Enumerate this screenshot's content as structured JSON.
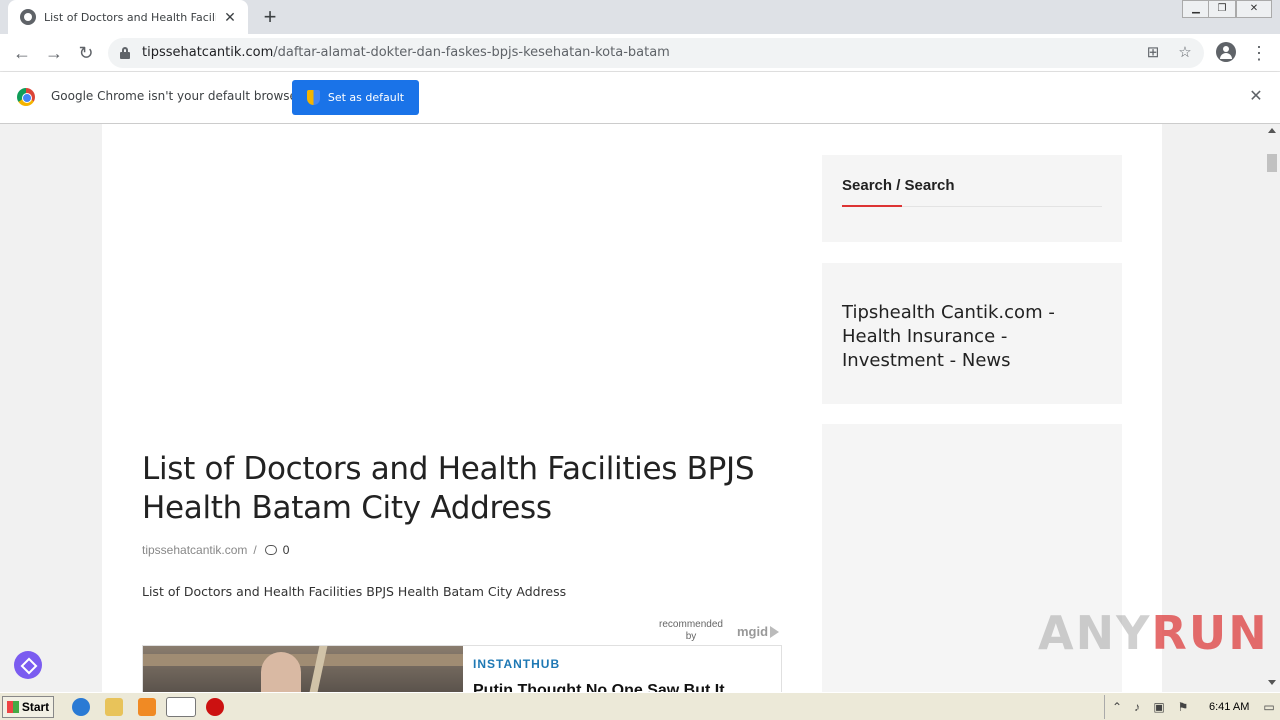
{
  "browser": {
    "tab_title": "List of Doctors and Health Facilities BPJS Health Batam City Address",
    "tab_close": "✕",
    "new_tab": "+",
    "url_domain": "tipssehatcantik.com",
    "url_path": "/daftar-alamat-dokter-dan-faskes-bpjs-kesehatan-kota-batam",
    "back": "←",
    "forward": "→",
    "reload": "↻",
    "translate_icon": "⊞",
    "bookmark_icon": "☆",
    "menu_icon": "⋮"
  },
  "infobar": {
    "message": "Google Chrome isn't your default browser",
    "button_label": "Set as default",
    "close": "✕"
  },
  "article": {
    "title": "List of Doctors and Health Facilities BPJS Health Batam City Address",
    "site": "tipssehatcantik.com",
    "separator": "/",
    "comment_count": "0",
    "excerpt": "List of Doctors and Health Facilities BPJS Health Batam City Address"
  },
  "ad": {
    "recommended_by": "recommended by",
    "provider": "mgid",
    "source": "INSTANTHUB",
    "headline": "Putin Thought No One Saw But It"
  },
  "sidebar": {
    "search_title": "Search / Search",
    "site_description": "Tipshealth Cantik.com - Health Insurance - Investment - News"
  },
  "watermark": {
    "text_a": "ANY",
    "text_b": "RUN"
  },
  "taskbar": {
    "start_label": "Start",
    "clock": "6:41 AM"
  }
}
